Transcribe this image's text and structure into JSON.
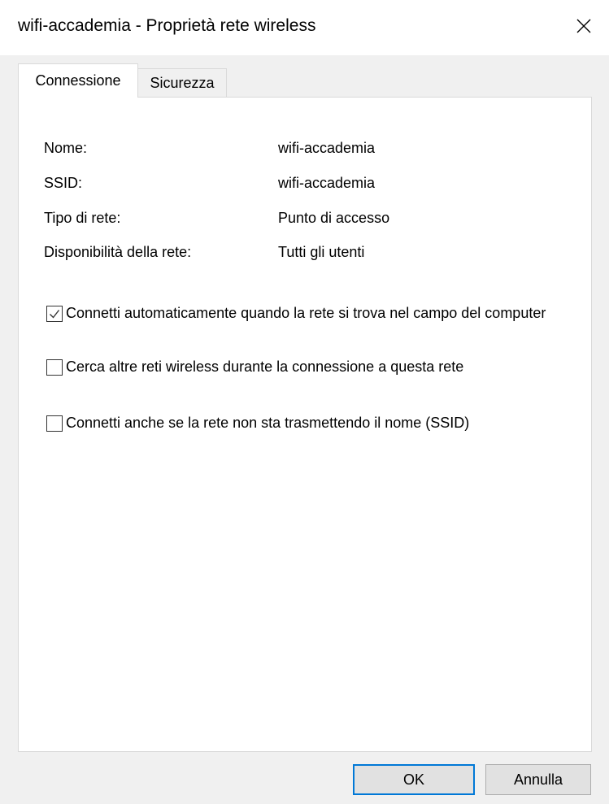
{
  "window": {
    "title": "wifi-accademia - Proprietà rete wireless",
    "close_icon": "close-icon"
  },
  "tabs": [
    {
      "label": "Connessione",
      "active": true
    },
    {
      "label": "Sicurezza",
      "active": false
    }
  ],
  "properties": [
    {
      "label": "Nome:",
      "value": "wifi-accademia"
    },
    {
      "label": "SSID:",
      "value": "wifi-accademia"
    },
    {
      "label": "Tipo di rete:",
      "value": "Punto di accesso"
    },
    {
      "label": "Disponibilità della rete:",
      "value": "Tutti gli utenti"
    }
  ],
  "options": [
    {
      "label": "Connetti automaticamente quando la rete si trova nel campo del computer",
      "checked": true
    },
    {
      "label": "Cerca altre reti wireless durante la connessione a questa rete",
      "checked": false
    },
    {
      "label": "Connetti anche se la rete non sta trasmettendo il nome (SSID)",
      "checked": false
    }
  ],
  "buttons": {
    "ok_label": "OK",
    "cancel_label": "Annulla"
  },
  "colors": {
    "accent": "#0078d7",
    "panel_border": "#d9d9d9",
    "dialog_background": "#f0f0f0"
  }
}
